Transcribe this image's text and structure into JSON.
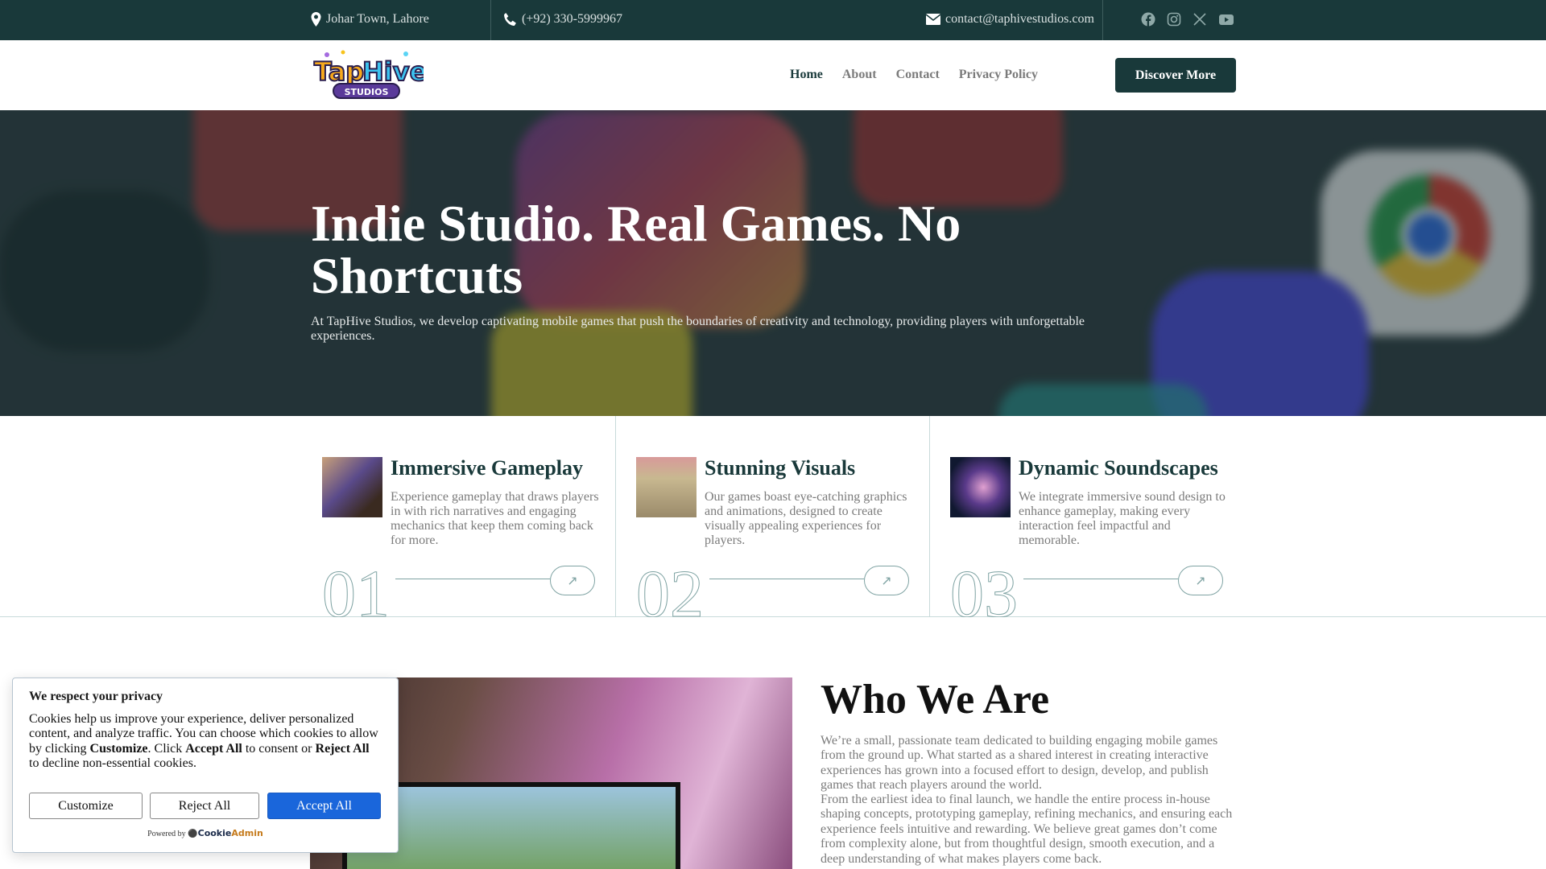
{
  "topbar": {
    "location": "Johar Town, Lahore",
    "phone": "(+92) 330-5999967",
    "email": "contact@taphivestudios.com"
  },
  "brand": {
    "logo_text": "TapHive",
    "logo_sub": "STUDIOS"
  },
  "nav": {
    "items": [
      "Home",
      "About",
      "Contact",
      "Privacy Policy"
    ],
    "cta": "Discover More"
  },
  "hero": {
    "title": "Indie Studio. Real Games. No Shortcuts",
    "text": "At TapHive Studios, we develop captivating mobile games that push the boundaries of creativity and technology, providing players with unforgettable experiences."
  },
  "features": [
    {
      "title": "Immersive Gameplay",
      "text": "Experience gameplay that draws players in with rich narratives and engaging mechanics that keep them coming back for more.",
      "number": "01"
    },
    {
      "title": "Stunning Visuals",
      "text": "Our games boast eye-catching graphics and animations, designed to create visually appealing experiences for players.",
      "number": "02"
    },
    {
      "title": "Dynamic Soundscapes",
      "text": "We integrate immersive sound design to enhance gameplay, making every interaction feel impactful and memorable.",
      "number": "03"
    }
  ],
  "who": {
    "title": "Who We Are",
    "p1": "We’re a small, passionate team dedicated to building engaging mobile games from the ground up. What started as a shared interest in creating interactive experiences has grown into a focused effort to design, develop, and publish games that reach players around the world.",
    "p2": "From the earliest idea to final launch, we handle the entire process in-house shaping concepts, prototyping gameplay, refining mechanics, and ensuring each experience feels intuitive and rewarding. We believe great games don’t come from complexity alone, but from thoughtful design, smooth execution, and a deep understanding of what makes players come back."
  },
  "cookie": {
    "title": "We respect your privacy",
    "t1": "Cookies help us improve your experience, deliver personalized content, and analyze traffic. You can choose which cookies to allow by clicking ",
    "b1": "Customize",
    "t2": ". Click ",
    "b2": "Accept All",
    "t3": " to consent or ",
    "b3": "Reject All",
    "t4": " to decline non-essential cookies.",
    "customize": "Customize",
    "reject": "Reject All",
    "accept": "Accept All",
    "powered": "Powered by",
    "brand1": "Cookie",
    "brand2": "Admin"
  }
}
